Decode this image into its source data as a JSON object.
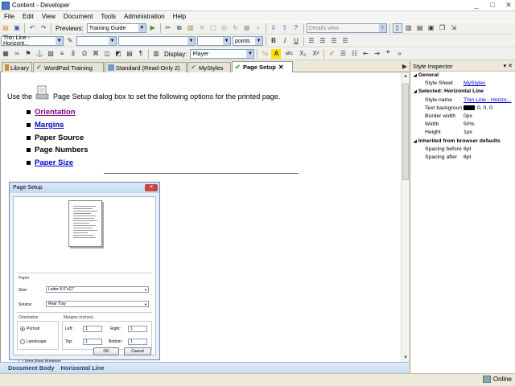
{
  "window": {
    "title": "Content - Developer",
    "controls": [
      "_",
      "□",
      "✕"
    ]
  },
  "menu": [
    "File",
    "Edit",
    "View",
    "Document",
    "Tools",
    "Administration",
    "Help"
  ],
  "toolbar1": {
    "preview_label": "Previews:",
    "preview_value": "Training Guide",
    "view_value": "Details view"
  },
  "toolbar2": {
    "style_value": "Thin Line - Horizont...",
    "font_value": "",
    "size_value": "",
    "units_value": "points",
    "bold": "B",
    "italic": "I",
    "underline": "U"
  },
  "toolbar3": {
    "display_label": "Display:",
    "display_value": "Player",
    "abc": "abc",
    "sub": "X₂",
    "sup": "X²",
    "omega": "Ω"
  },
  "tabs": [
    {
      "label": "Library",
      "active": false
    },
    {
      "label": "WordPad Training",
      "active": false
    },
    {
      "label": "Standard (Read-Only 2)",
      "active": false
    },
    {
      "label": "MyStyles",
      "active": false
    },
    {
      "label": "Page Setup",
      "active": true
    }
  ],
  "tab_close": "✕",
  "tabs_overflow": "▶",
  "document": {
    "intro_before": "Use the",
    "intro_after": "Page Setup dialog box to set the following options for the printed page.",
    "items": [
      {
        "label": "Orientation",
        "link": true,
        "visited": true
      },
      {
        "label": "Margins",
        "link": true,
        "visited": false
      },
      {
        "label": "Paper Source",
        "link": false,
        "visited": false
      },
      {
        "label": "Page Numbers",
        "link": false,
        "visited": false
      },
      {
        "label": "Paper Size",
        "link": true,
        "visited": false
      }
    ]
  },
  "dialog": {
    "title": "Page Setup",
    "paper_section": "Paper",
    "size_label": "Size:",
    "size_value": "Letter 8.5\"x11\"",
    "source_label": "Source:",
    "source_value": "Rear Tray",
    "orientation_section": "Orientation",
    "portrait": "Portrait",
    "landscape": "Landscape",
    "margins_section": "Margins (inches)",
    "left_label": "Left:",
    "left_value": "1",
    "right_label": "Right:",
    "right_value": "1",
    "top_label": "Top:",
    "top_value": "1",
    "bottom_label": "Bottom:",
    "bottom_value": "1",
    "print_page_numbers": "Print Page Numbers",
    "ok": "OK",
    "cancel": "Cancel"
  },
  "breadcrumbs": [
    "Document Body",
    "Horizontal Line"
  ],
  "inspector": {
    "title": "Style Inspector",
    "general_head": "General",
    "style_sheet_key": "Style Sheet",
    "style_sheet_val": "MyStyles",
    "selected_head": "Selected: Horizontal Line",
    "style_name_key": "Style name",
    "style_name_val": "Thin Line - Horizo...",
    "text_bg_key": "Text backgroun",
    "text_bg_val": "0, 0, 0",
    "border_width_key": "Border width",
    "border_width_val": "0px",
    "width_key": "Width",
    "width_val": "50%",
    "height_key": "Height",
    "height_val": "1px",
    "inherited_head": "Inherited from browser defaults",
    "spacing_before_key": "Spacing before",
    "spacing_before_val": "6pt",
    "spacing_after_key": "Spacing after",
    "spacing_after_val": "6pt"
  },
  "status": {
    "online": "Online"
  }
}
